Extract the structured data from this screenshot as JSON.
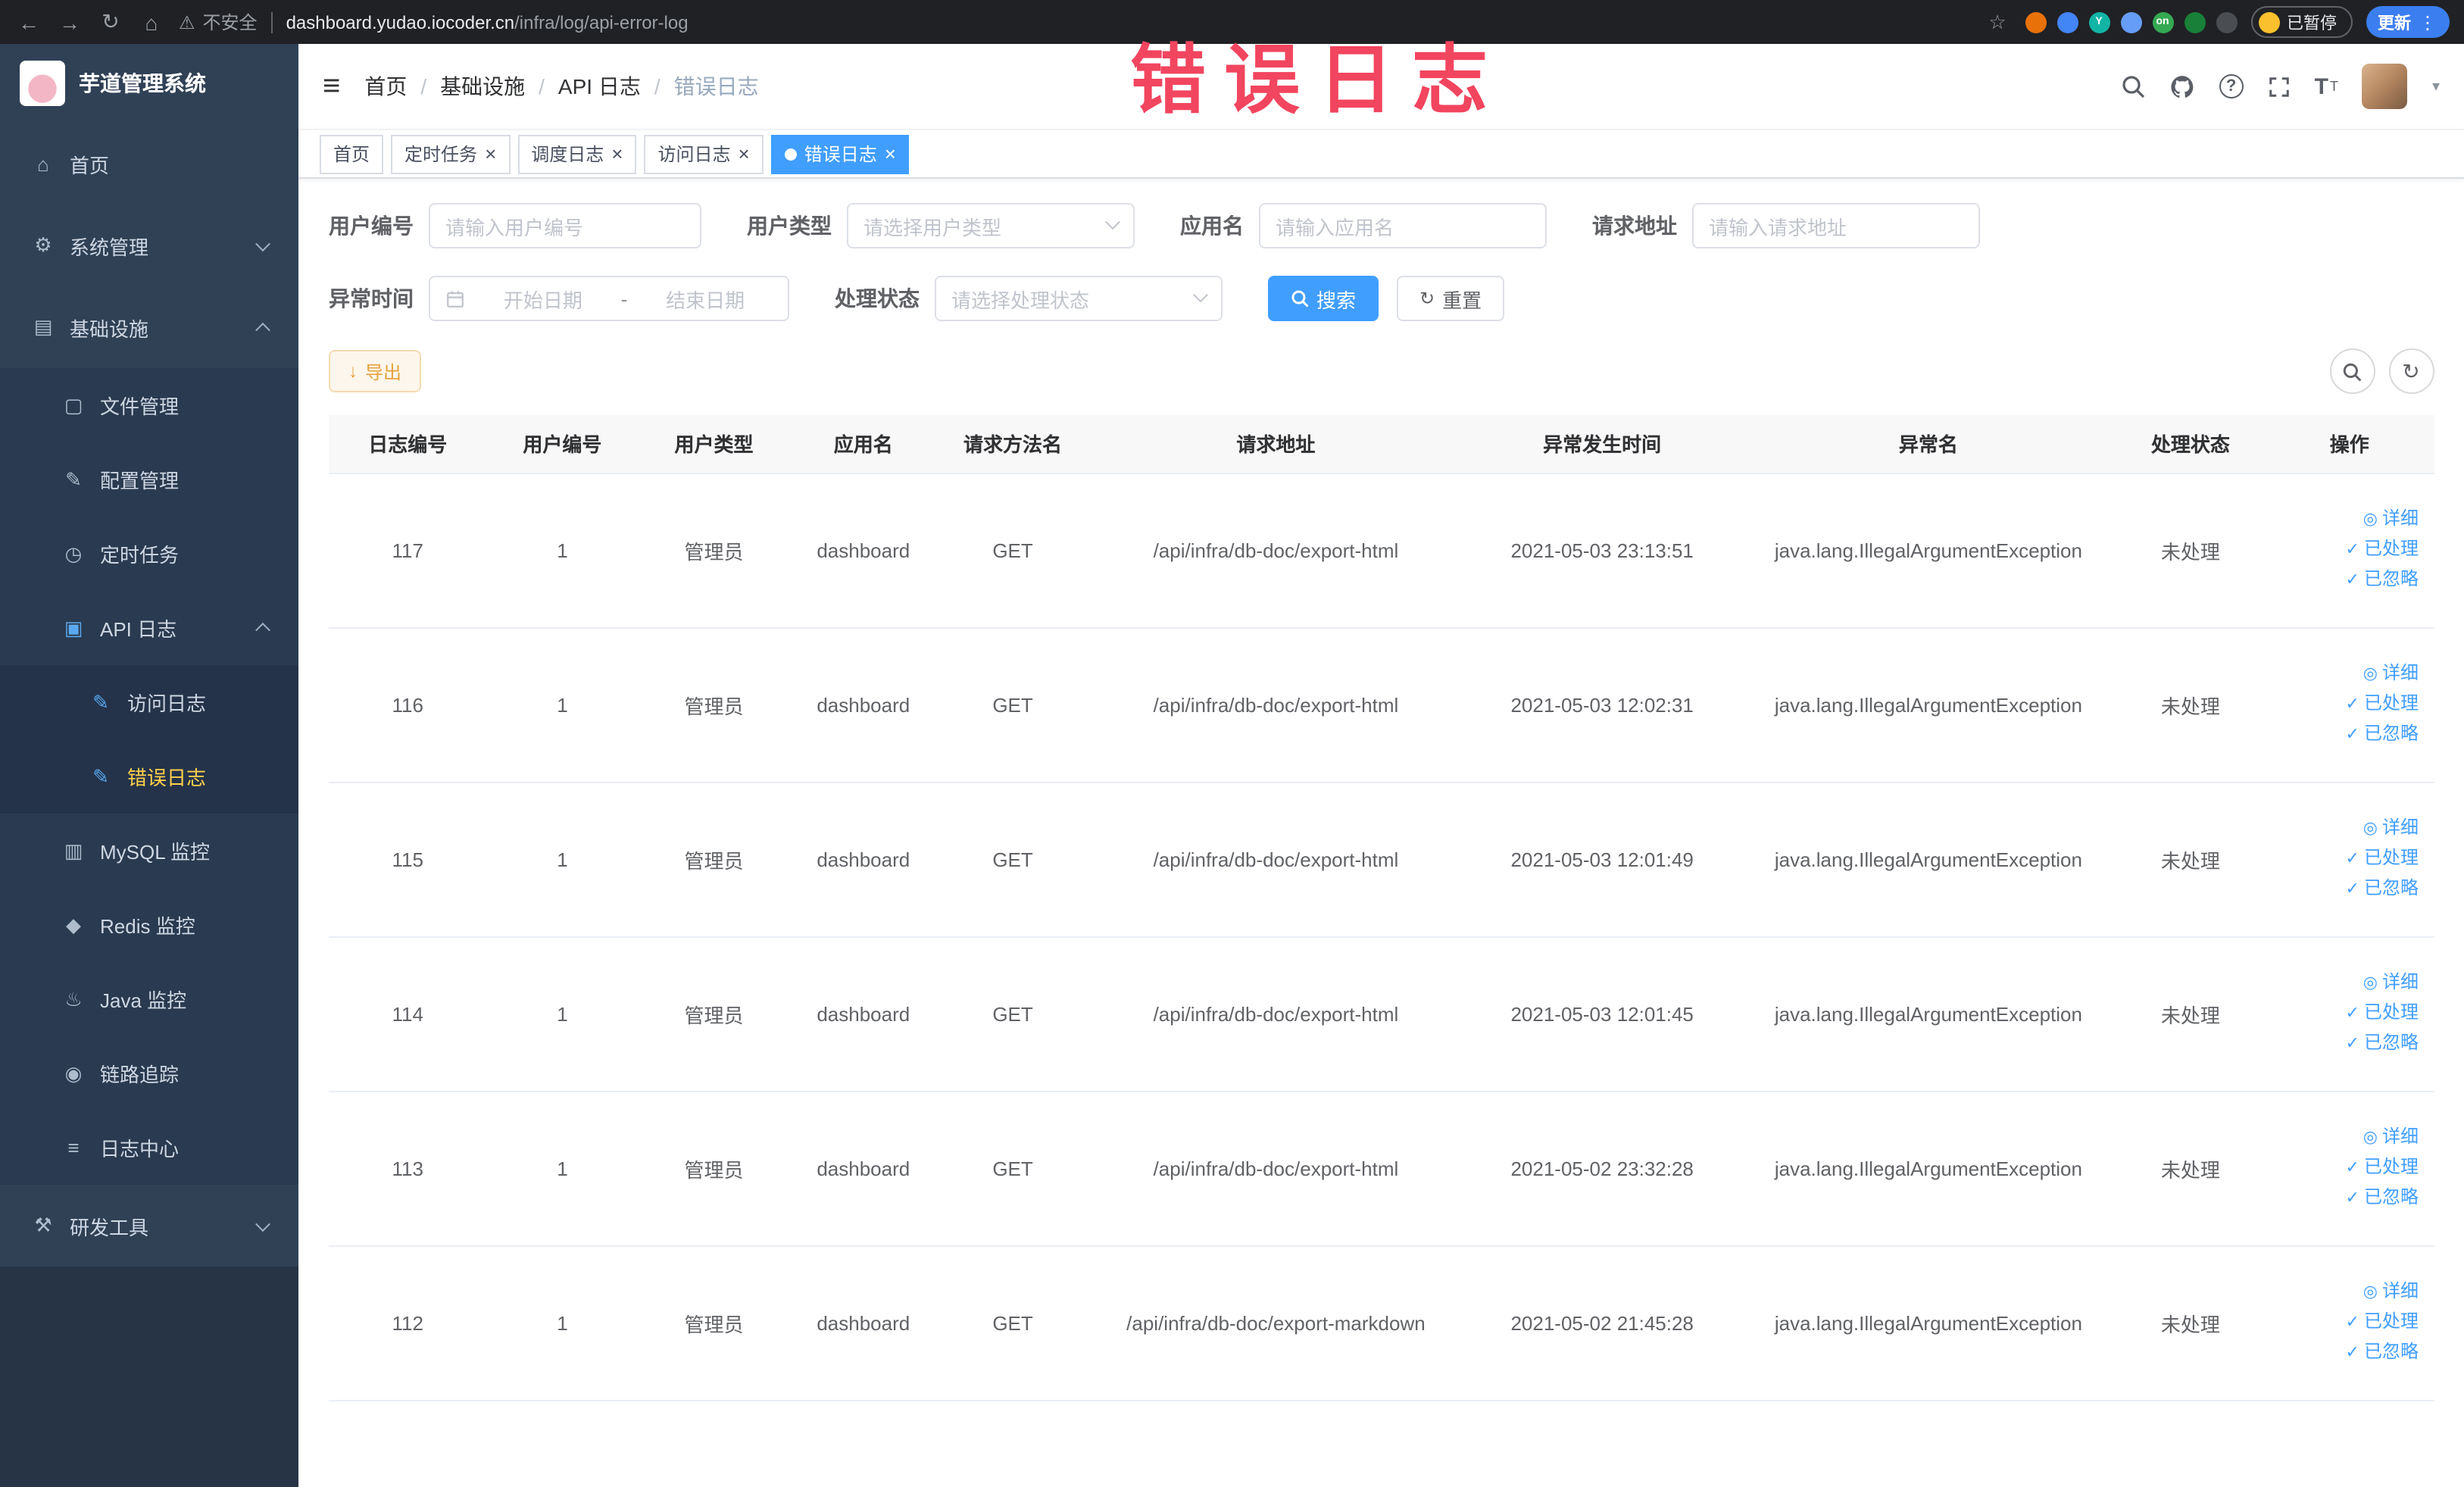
{
  "browser": {
    "back_icon": "←",
    "forward_icon": "→",
    "reload_icon": "↻",
    "home_icon": "⌂",
    "warning_icon": "⚠",
    "security_label": "不安全",
    "url_host": "dashboard.yudao.iocoder.cn",
    "url_path": "/infra/log/api-error-log",
    "star_icon": "☆",
    "menu_icon": "⋮",
    "paused_label": "已暂停",
    "update_label": "更新",
    "extensions": [
      {
        "name": "extension-orange-icon",
        "color": "#e8710a"
      },
      {
        "name": "extension-blue-icon",
        "color": "#4285f4"
      },
      {
        "name": "extension-teal-icon",
        "color": "#12b5a5",
        "label": "Y"
      },
      {
        "name": "extension-grid-icon",
        "color": "#669df6"
      },
      {
        "name": "extension-on-icon",
        "color": "#34a853",
        "label": "on"
      },
      {
        "name": "extension-green-icon",
        "color": "#188038"
      },
      {
        "name": "extension-dark-icon",
        "color": "#4a4d51"
      }
    ]
  },
  "annotation": {
    "text": "错误日志"
  },
  "sidebar": {
    "logo_title": "芋道管理系统",
    "items": [
      {
        "key": "home",
        "label": "首页",
        "icon": "home-icon",
        "glyph": "⌂",
        "level": 1
      },
      {
        "key": "system-management",
        "label": "系统管理",
        "icon": "gear-icon",
        "glyph": "⚙",
        "level": 1,
        "arrow": "down"
      },
      {
        "key": "infrastructure",
        "label": "基础设施",
        "icon": "monitor-icon",
        "glyph": "▤",
        "level": 1,
        "arrow": "up"
      },
      {
        "key": "file-management",
        "label": "文件管理",
        "icon": "cloud-icon",
        "glyph": "▢",
        "level": 2
      },
      {
        "key": "config-management",
        "label": "配置管理",
        "icon": "edit-icon",
        "glyph": "✎",
        "level": 2
      },
      {
        "key": "scheduled-jobs",
        "label": "定时任务",
        "icon": "clock-icon",
        "glyph": "◷",
        "level": 2
      },
      {
        "key": "api-log",
        "label": "API 日志",
        "icon": "document-icon",
        "glyph": "▣",
        "level": 2,
        "arrow": "up",
        "icon_blue": true
      },
      {
        "key": "access-log",
        "label": "访问日志",
        "icon": "document-edit-icon",
        "glyph": "✎",
        "level": 3,
        "icon_blue": true
      },
      {
        "key": "error-log",
        "label": "错误日志",
        "icon": "document-edit-icon",
        "glyph": "✎",
        "level": 3,
        "icon_blue": true,
        "active": true
      },
      {
        "key": "mysql-monitor",
        "label": "MySQL 监控",
        "icon": "database-icon",
        "glyph": "▥",
        "level": 2
      },
      {
        "key": "redis-monitor",
        "label": "Redis 监控",
        "icon": "redis-icon",
        "glyph": "◆",
        "level": 2
      },
      {
        "key": "java-monitor",
        "label": "Java 监控",
        "icon": "java-icon",
        "glyph": "♨",
        "level": 2
      },
      {
        "key": "tracing",
        "label": "链路追踪",
        "icon": "eye-icon",
        "glyph": "◉",
        "level": 2
      },
      {
        "key": "log-center",
        "label": "日志中心",
        "icon": "log-icon",
        "glyph": "≡",
        "level": 2
      },
      {
        "key": "dev-tools",
        "label": "研发工具",
        "icon": "tools-icon",
        "glyph": "⚒",
        "level": 1,
        "arrow": "down"
      }
    ]
  },
  "header": {
    "hamburger_icon": "≡",
    "question_mark": "?",
    "font_size_icon": "T",
    "caret_icon": "▾"
  },
  "breadcrumb": {
    "separator": "/",
    "items": [
      "首页",
      "基础设施",
      "API 日志",
      "错误日志"
    ]
  },
  "tabs": [
    {
      "key": "home",
      "label": "首页",
      "closable": false,
      "active": false
    },
    {
      "key": "scheduled-jobs",
      "label": "定时任务",
      "closable": true,
      "active": false
    },
    {
      "key": "job-log",
      "label": "调度日志",
      "closable": true,
      "active": false
    },
    {
      "key": "access-log",
      "label": "访问日志",
      "closable": true,
      "active": false
    },
    {
      "key": "error-log",
      "label": "错误日志",
      "closable": true,
      "active": true
    }
  ],
  "ui": {
    "close_icon": "×"
  },
  "filters": {
    "user_id": {
      "label": "用户编号",
      "placeholder": "请输入用户编号"
    },
    "user_type": {
      "label": "用户类型",
      "placeholder": "请选择用户类型"
    },
    "app_name": {
      "label": "应用名",
      "placeholder": "请输入应用名"
    },
    "request_url": {
      "label": "请求地址",
      "placeholder": "请输入请求地址"
    },
    "exception_time": {
      "label": "异常时间",
      "start_placeholder": "开始日期",
      "separator": "-",
      "end_placeholder": "结束日期"
    },
    "process_status": {
      "label": "处理状态",
      "placeholder": "请选择处理状态"
    },
    "search_label": "搜索",
    "reset_label": "重置",
    "reset_icon": "↻"
  },
  "toolbar": {
    "export_label": "导出",
    "export_icon": "↓",
    "refresh_icon": "↻"
  },
  "table": {
    "columns": [
      "日志编号",
      "用户编号",
      "用户类型",
      "应用名",
      "请求方法名",
      "请求地址",
      "异常发生时间",
      "异常名",
      "处理状态",
      "操作"
    ],
    "rows": [
      {
        "id": "117",
        "user_id": "1",
        "user_type": "管理员",
        "app": "dashboard",
        "method": "GET",
        "url": "/api/infra/db-doc/export-html",
        "time": "2021-05-03 23:13:51",
        "exception": "java.lang.IllegalArgumentException",
        "status": "未处理"
      },
      {
        "id": "116",
        "user_id": "1",
        "user_type": "管理员",
        "app": "dashboard",
        "method": "GET",
        "url": "/api/infra/db-doc/export-html",
        "time": "2021-05-03 12:02:31",
        "exception": "java.lang.IllegalArgumentException",
        "status": "未处理"
      },
      {
        "id": "115",
        "user_id": "1",
        "user_type": "管理员",
        "app": "dashboard",
        "method": "GET",
        "url": "/api/infra/db-doc/export-html",
        "time": "2021-05-03 12:01:49",
        "exception": "java.lang.IllegalArgumentException",
        "status": "未处理"
      },
      {
        "id": "114",
        "user_id": "1",
        "user_type": "管理员",
        "app": "dashboard",
        "method": "GET",
        "url": "/api/infra/db-doc/export-html",
        "time": "2021-05-03 12:01:45",
        "exception": "java.lang.IllegalArgumentException",
        "status": "未处理"
      },
      {
        "id": "113",
        "user_id": "1",
        "user_type": "管理员",
        "app": "dashboard",
        "method": "GET",
        "url": "/api/infra/db-doc/export-html",
        "time": "2021-05-02 23:32:28",
        "exception": "java.lang.IllegalArgumentException",
        "status": "未处理"
      },
      {
        "id": "112",
        "user_id": "1",
        "user_type": "管理员",
        "app": "dashboard",
        "method": "GET",
        "url": "/api/infra/db-doc/export-markdown",
        "time": "2021-05-02 21:45:28",
        "exception": "java.lang.IllegalArgumentException",
        "status": "未处理"
      }
    ],
    "actions": {
      "detail": "详细",
      "processed": "已处理",
      "ignored": "已忽略"
    },
    "action_icons": {
      "detail": "◎",
      "processed": "✓",
      "ignored": "✓"
    }
  },
  "colors": {
    "accent": "#409eff",
    "sidebar_bg": "#304156",
    "active_menu_text": "#ffd04b",
    "warning": "#e6a23c",
    "annotation": "#f2455f",
    "table_header_bg": "#f8f8f9"
  }
}
